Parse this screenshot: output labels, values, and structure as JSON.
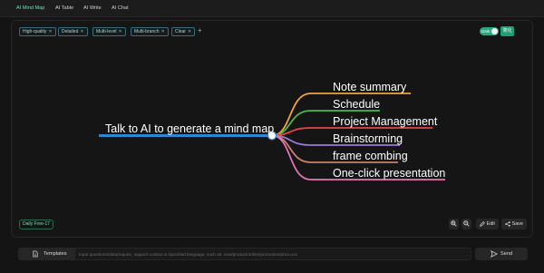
{
  "tabs": [
    {
      "label": "AI Mind Map",
      "active": true
    },
    {
      "label": "AI Table",
      "active": false
    },
    {
      "label": "AI Write",
      "active": false
    },
    {
      "label": "AI Chat",
      "active": false
    }
  ],
  "chips": [
    {
      "label": "High-quality"
    },
    {
      "label": "Detailed"
    },
    {
      "label": "Multi-level"
    },
    {
      "label": "Multi-branch"
    },
    {
      "label": "Clear"
    }
  ],
  "add_chip_label": "+",
  "theme_toggle": {
    "label": "Dark",
    "on": true
  },
  "lang_button": "简化",
  "mindmap": {
    "root": "Talk to AI to generate a mind map",
    "root_color": "#2f86d6",
    "branches": [
      {
        "label": "Note summary",
        "color": "#f0a33a"
      },
      {
        "label": "Schedule",
        "color": "#3fbf4a"
      },
      {
        "label": "Project Management",
        "color": "#e64545"
      },
      {
        "label": "Brainstorming",
        "color": "#9a7ad8"
      },
      {
        "label": "frame combing",
        "color": "#c9826a"
      },
      {
        "label": "One-click presentation",
        "color": "#e873b8"
      }
    ]
  },
  "daily_badge": "Daily Free-17",
  "toolbar": {
    "zoom_in_icon": "zoom-in-icon",
    "zoom_out_icon": "zoom-out-icon",
    "edit_label": "Edit",
    "save_label": "Save"
  },
  "bottom": {
    "templates_label": "Templates",
    "prompt_placeholder": "Input questions/data/require, support context & Specified language, such as: new/product/online/promotion/price.xxx",
    "send_label": "Send"
  },
  "colors": {
    "accent": "#2ea57f",
    "chip_border": "#3a6c79"
  }
}
